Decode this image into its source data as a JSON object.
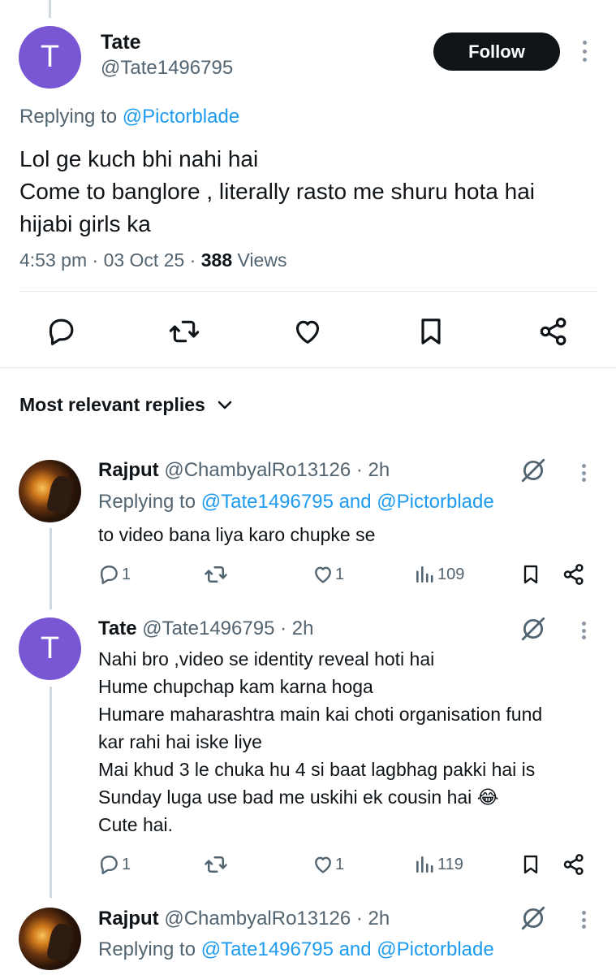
{
  "main_tweet": {
    "avatar_letter": "T",
    "name": "Tate",
    "handle": "@Tate1496795",
    "follow_label": "Follow",
    "replying_prefix": "Replying to ",
    "replying_to": "@Pictorblade",
    "text_lines": [
      "Lol ge kuch bhi nahi hai",
      "Come to banglore , literally rasto me shuru hota hai",
      "hijabi girls ka"
    ],
    "time": "4:53 pm",
    "date": "03 Oct 25",
    "views_count": "388",
    "views_label": " Views",
    "separator": " · "
  },
  "section": {
    "title": "Most relevant replies"
  },
  "replies": [
    {
      "name": "Rajput",
      "handle": "@ChambyalRo13126",
      "age": " · 2h",
      "replying_prefix": "Replying to ",
      "replying_to": "@Tate1496795 and @Pictorblade",
      "text_lines": [
        "to video bana liya karo chupke se"
      ],
      "reply_count": "1",
      "like_count": "1",
      "view_count": "109"
    },
    {
      "avatar_letter": "T",
      "name": "Tate",
      "handle": "@Tate1496795",
      "age": " · 2h",
      "text_lines": [
        "Nahi bro ,video se identity reveal hoti hai",
        "Hume chupchap kam karna hoga",
        "Humare maharashtra main kai choti organisation fund",
        "kar rahi hai iske liye",
        "Mai khud 3 le chuka hu 4 si baat lagbhag pakki hai is",
        "Sunday luga use bad me uskihi ek cousin hai 😂",
        "Cute hai."
      ],
      "reply_count": "1",
      "like_count": "1",
      "view_count": "119"
    },
    {
      "name": "Rajput",
      "handle": "@ChambyalRo13126",
      "age": " · 2h",
      "replying_prefix": "Replying to ",
      "replying_to": "@Tate1496795 and @Pictorblade"
    }
  ],
  "colors": {
    "accent": "#1d9bf0",
    "avatar": "#7856d4",
    "muted": "#536471",
    "text": "#0f1419"
  }
}
